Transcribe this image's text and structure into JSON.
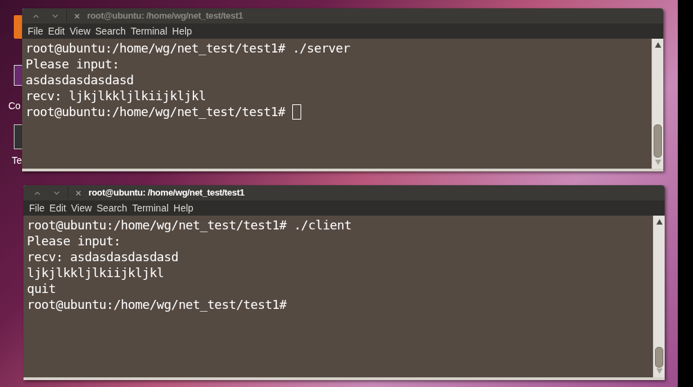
{
  "desktop_icons": [
    {
      "label": "Co"
    },
    {
      "label": "Te"
    }
  ],
  "windows": [
    {
      "title": "root@ubuntu: /home/wg/net_test/test1",
      "active": false,
      "menu": [
        "File",
        "Edit",
        "View",
        "Search",
        "Terminal",
        "Help"
      ],
      "lines": [
        "root@ubuntu:/home/wg/net_test/test1# ./server",
        "Please input:",
        "asdasdasdasdasd",
        "recv: ljkjlkkljlkiijkljkl",
        "root@ubuntu:/home/wg/net_test/test1# "
      ],
      "cursor": true
    },
    {
      "title": "root@ubuntu: /home/wg/net_test/test1",
      "active": true,
      "menu": [
        "File",
        "Edit",
        "View",
        "Search",
        "Terminal",
        "Help"
      ],
      "lines": [
        "root@ubuntu:/home/wg/net_test/test1# ./client",
        "Please input:",
        "recv: asdasdasdasdasd",
        "ljkjlkkljlkiijkljkl",
        "quit",
        "root@ubuntu:/home/wg/net_test/test1#"
      ],
      "cursor": false
    }
  ]
}
